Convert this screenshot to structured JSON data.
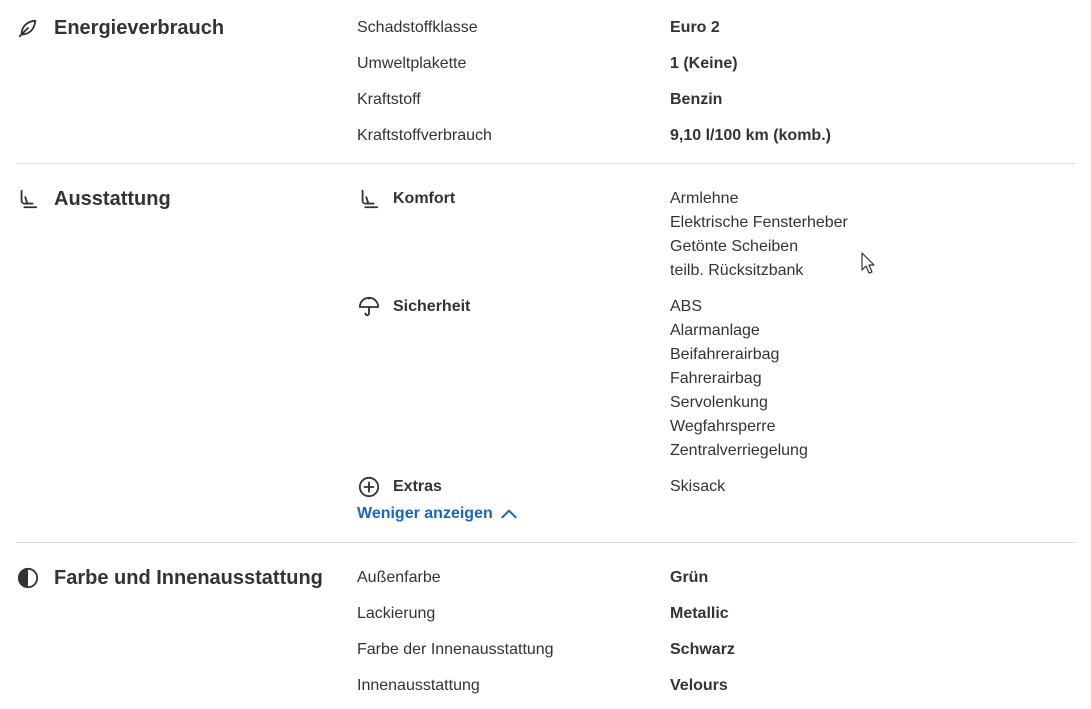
{
  "energy": {
    "title": "Energieverbrauch",
    "icon": "leaf-icon",
    "rows": [
      {
        "label": "Schadstoffklasse",
        "value": "Euro 2"
      },
      {
        "label": "Umweltplakette",
        "value": "1 (Keine)"
      },
      {
        "label": "Kraftstoff",
        "value": "Benzin"
      },
      {
        "label": "Kraftstoffverbrauch",
        "value": "9,10 l/100 km (komb.)"
      }
    ]
  },
  "equipment": {
    "title": "Ausstattung",
    "icon": "car-seat-icon",
    "groups": [
      {
        "title": "Komfort",
        "icon": "car-seat-icon",
        "items": [
          "Armlehne",
          "Elektrische Fensterheber",
          "Getönte Scheiben",
          "teilb. Rücksitzbank"
        ]
      },
      {
        "title": "Sicherheit",
        "icon": "umbrella-icon",
        "items": [
          "ABS",
          "Alarmanlage",
          "Beifahrerairbag",
          "Fahrerairbag",
          "Servolenkung",
          "Wegfahrsperre",
          "Zentralverriegelung"
        ]
      },
      {
        "title": "Extras",
        "icon": "plus-circle-icon",
        "items": [
          "Skisack"
        ]
      }
    ],
    "toggle_label": "Weniger anzeigen",
    "toggle_icon": "chevron-up-icon"
  },
  "color": {
    "title": "Farbe und Innenausstattung",
    "icon": "half-circle-icon",
    "rows": [
      {
        "label": "Außenfarbe",
        "value": "Grün"
      },
      {
        "label": "Lackierung",
        "value": "Metallic"
      },
      {
        "label": "Farbe der Innenausstattung",
        "value": "Schwarz"
      },
      {
        "label": "Innenausstattung",
        "value": "Velours"
      }
    ]
  },
  "colors": {
    "text": "#333333",
    "link": "#1a64c2",
    "divider": "#dcdcdc"
  }
}
